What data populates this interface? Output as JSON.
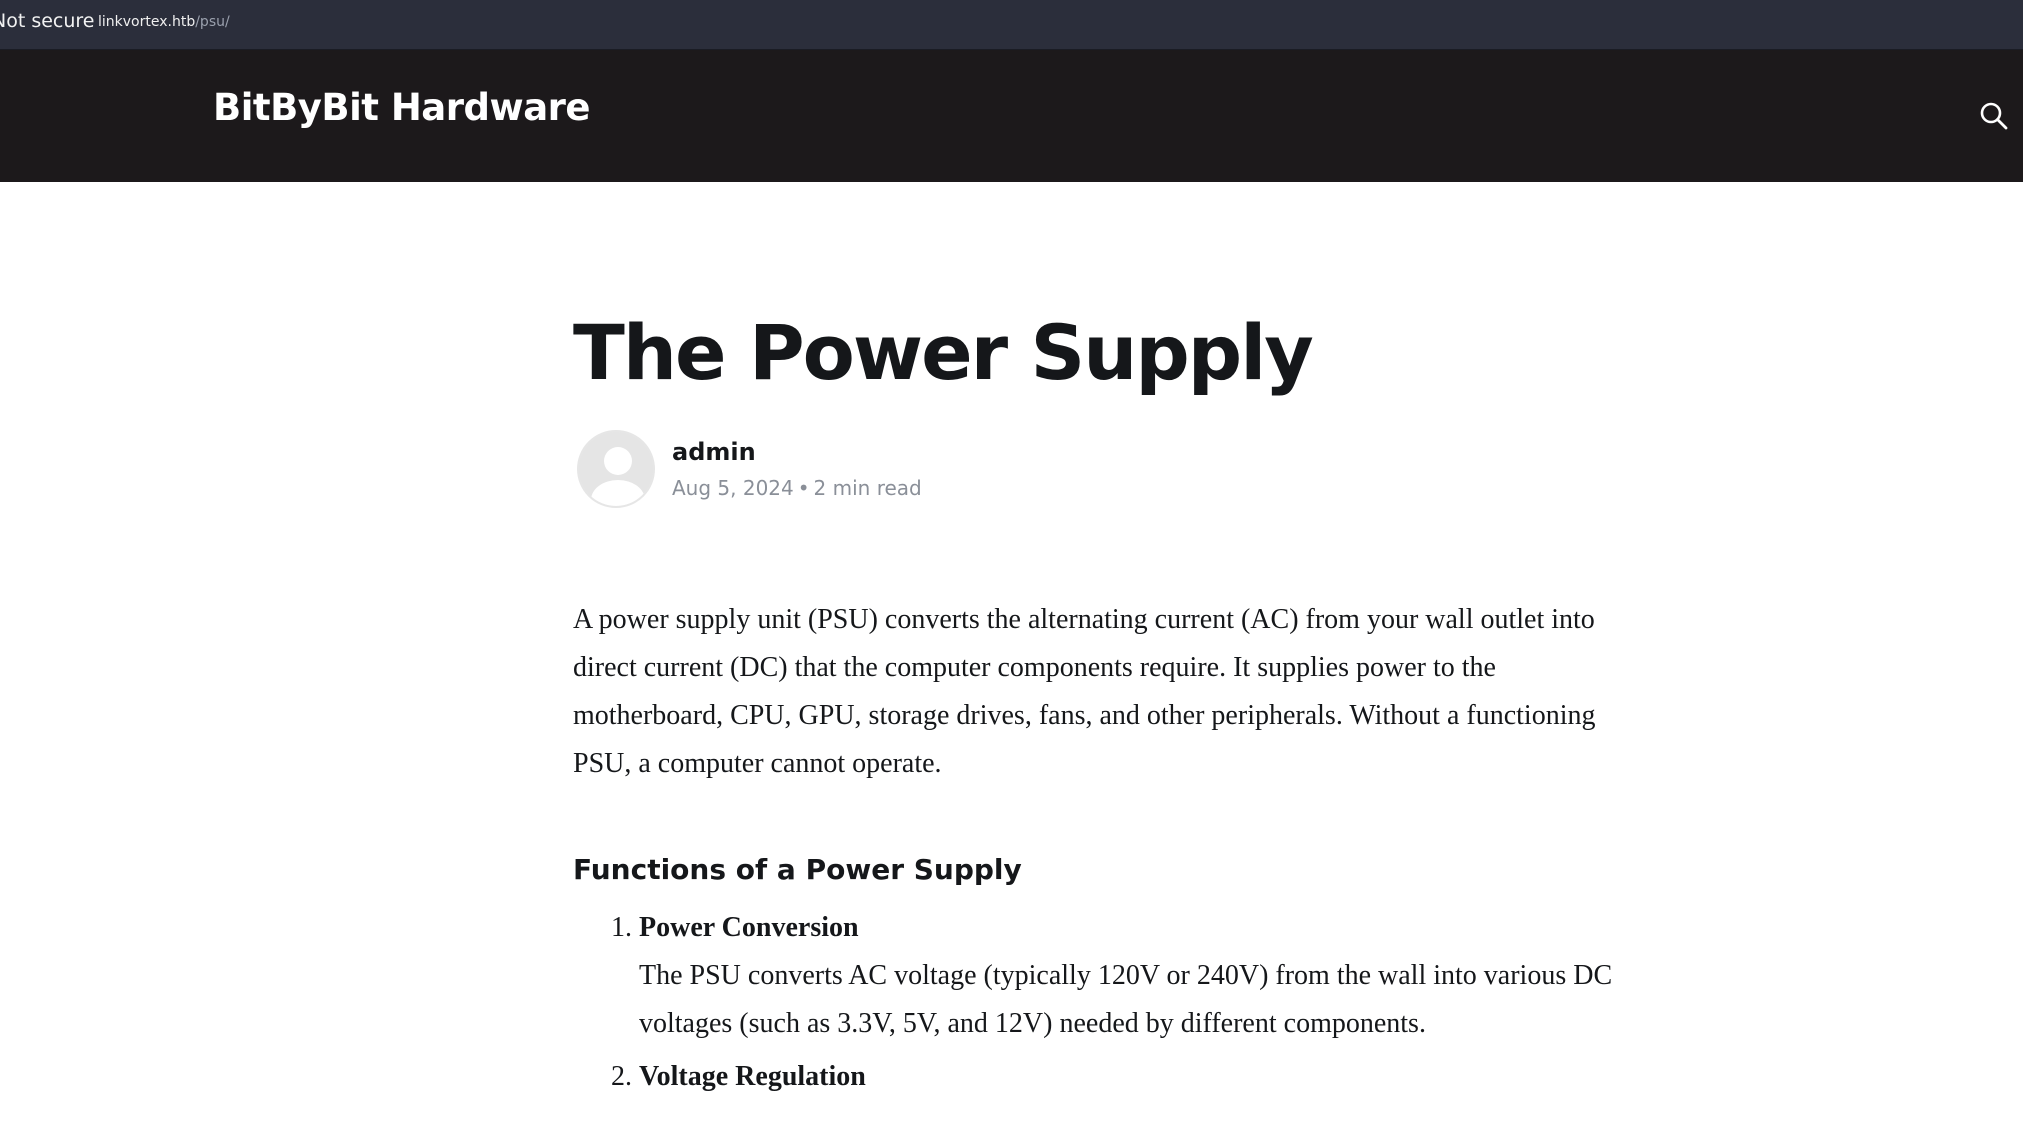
{
  "browser": {
    "security_label": "Not secure",
    "url_host": "linkvortex.htb",
    "url_path": "/psu/"
  },
  "header": {
    "site_title": "BitByBit Hardware",
    "search_icon": "search-icon"
  },
  "post": {
    "title": "The Power Supply",
    "author": "admin",
    "date": "Aug 5, 2024",
    "separator": "•",
    "reading_time": "2 min read",
    "avatar_icon": "user-avatar-icon",
    "intro": "A power supply unit (PSU) converts the alternating current (AC) from your wall outlet into direct current (DC) that the computer components require. It supplies power to the motherboard, CPU, GPU, storage drives, fans, and other peripherals. Without a functioning PSU, a computer cannot operate.",
    "section_heading": "Functions of a Power Supply",
    "functions": [
      {
        "title": "Power Conversion",
        "text": "The PSU converts AC voltage (typically 120V or 240V) from the wall into various DC voltages (such as 3.3V, 5V, and 12V) needed by different components."
      },
      {
        "title": "Voltage Regulation",
        "text": ""
      }
    ]
  },
  "colors": {
    "header_bg": "#1c191b",
    "urlbar_bg": "#2b2e3b",
    "text": "#15171a",
    "meta": "#8a8f98"
  }
}
